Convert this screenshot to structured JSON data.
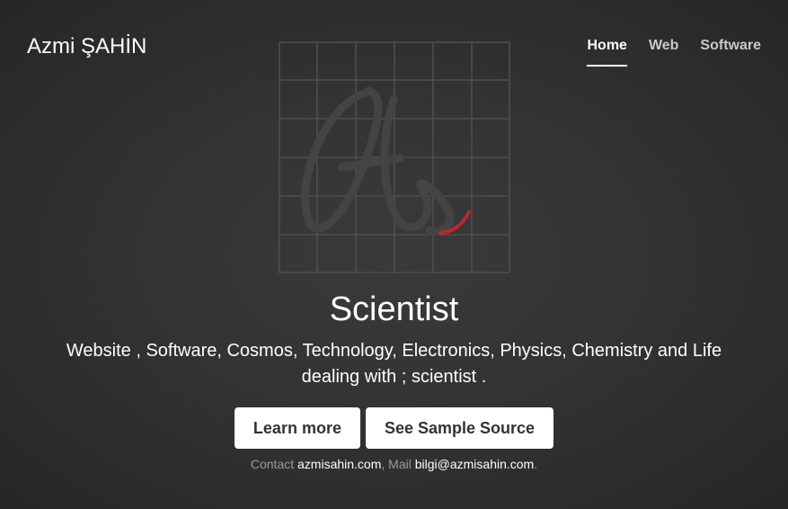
{
  "header": {
    "brand": "Azmi ŞAHİN"
  },
  "nav": {
    "items": [
      "Home",
      "Web",
      "Software"
    ],
    "active": "Home"
  },
  "main": {
    "heading": "Scientist",
    "lead": "Website , Software, Cosmos, Technology, Electronics, Physics, Chemistry and Life dealing with ; scientist .",
    "buttons": {
      "learn_more": "Learn more",
      "sample_source": "See Sample Source"
    }
  },
  "footer": {
    "contact_label": "Contact",
    "contact_site": "azmisahin.com",
    "separator": ",",
    "mail_label": "Mail",
    "mail_address": "bilgi@azmisahin.com",
    "end": "."
  },
  "colors": {
    "background": "#333333",
    "accent": "#c0262d",
    "text": "#ffffff",
    "muted": "#9a9a9a"
  },
  "icons": {
    "logo": "azmi-sahin-monogram-grid-logo"
  }
}
